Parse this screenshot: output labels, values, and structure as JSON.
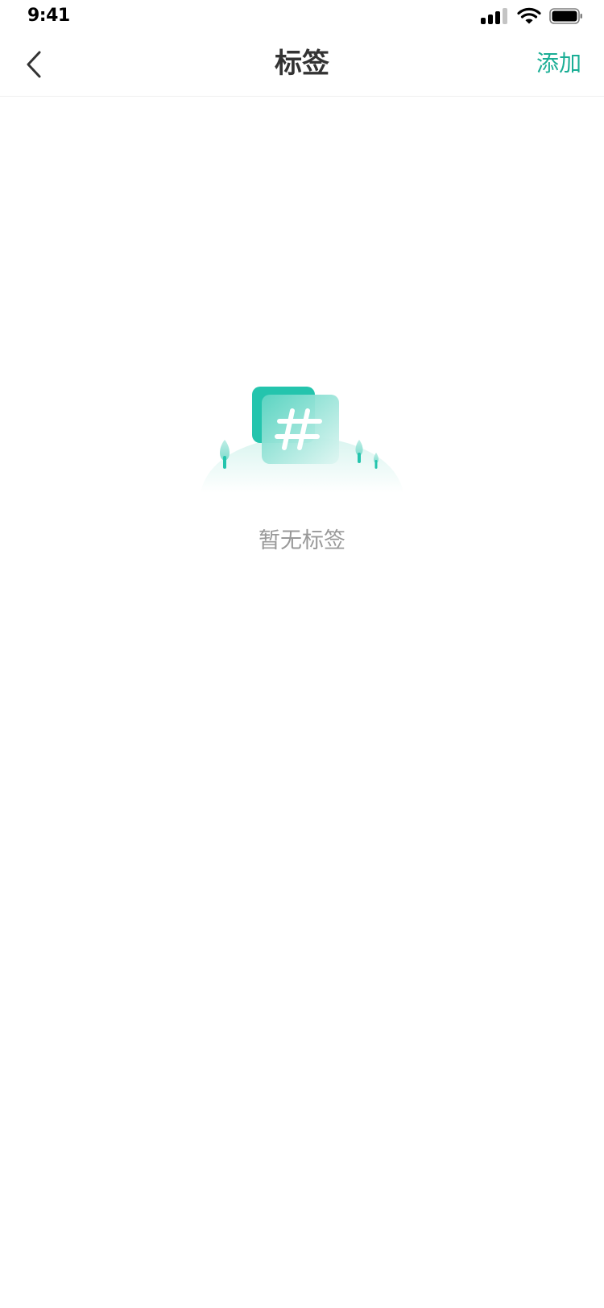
{
  "status_bar": {
    "time": "9:41",
    "icons": [
      "signal-icon",
      "wifi-icon",
      "battery-icon"
    ]
  },
  "nav": {
    "back_icon": "chevron-left-icon",
    "title": "标签",
    "action_label": "添加"
  },
  "empty_state": {
    "illustration_icon": "hashtag-icon",
    "message": "暂无标签"
  },
  "colors": {
    "accent": "#1aae95",
    "illustration_primary": "#24c4ad",
    "title_text": "#333333",
    "muted_text": "#999999",
    "divider": "#efefef"
  }
}
